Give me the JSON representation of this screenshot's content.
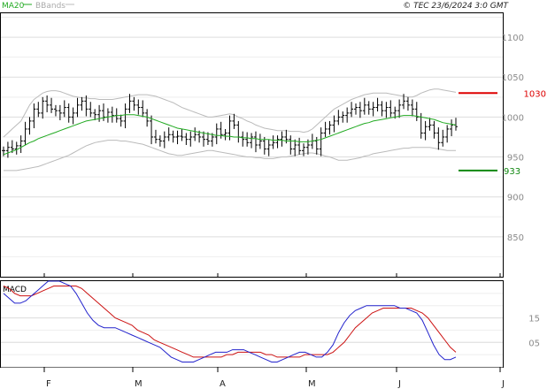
{
  "header": {
    "legend_ma": "MA20",
    "legend_bb": "BBands",
    "copyright": "© TEC 23/6/2024 3:0 GMT"
  },
  "colors": {
    "ma": "#22aa22",
    "bbands": "#bbbbbb",
    "bars": "#000000",
    "grid": "#dddddd",
    "resistance": "#dd0000",
    "support": "#118811",
    "macd": "#2222cc",
    "signal": "#cc1111"
  },
  "chart_data": [
    {
      "type": "ohlc",
      "title": "",
      "ylim": [
        800,
        1130
      ],
      "yticks": [
        850,
        900,
        950,
        1000,
        1050,
        1100
      ],
      "ytick_labels": [
        "850",
        "900",
        "950",
        "1000",
        "1050",
        "1100"
      ],
      "x_months": [
        "F",
        "M",
        "A",
        "M",
        "J",
        "J"
      ],
      "closes": [
        958,
        962,
        960,
        964,
        970,
        985,
        995,
        1010,
        1005,
        1020,
        1015,
        1010,
        1008,
        1005,
        1012,
        1000,
        1005,
        1015,
        1020,
        1010,
        1005,
        1003,
        1008,
        1000,
        1006,
        1002,
        998,
        995,
        1010,
        1020,
        1015,
        1012,
        1005,
        995,
        975,
        972,
        970,
        975,
        978,
        975,
        976,
        975,
        972,
        975,
        978,
        975,
        972,
        970,
        975,
        985,
        978,
        980,
        995,
        990,
        975,
        972,
        968,
        975,
        965,
        970,
        960,
        965,
        968,
        972,
        975,
        972,
        960,
        965,
        958,
        962,
        965,
        970,
        960,
        980,
        985,
        990,
        995,
        1000,
        1002,
        1005,
        1010,
        1012,
        1008,
        1015,
        1010,
        1012,
        1015,
        1008,
        1012,
        1005,
        1008,
        1015,
        1020,
        1015,
        1010,
        1000,
        980,
        988,
        990,
        980,
        968,
        975,
        985,
        990,
        988
      ],
      "ma20": [
        953,
        955,
        957,
        959,
        962,
        965,
        968,
        970,
        973,
        975,
        977,
        979,
        981,
        983,
        985,
        987,
        989,
        991,
        993,
        995,
        996,
        997,
        998,
        999,
        1000,
        1001,
        1002,
        1002,
        1003,
        1003,
        1003,
        1002,
        1001,
        1000,
        998,
        996,
        994,
        992,
        990,
        988,
        986,
        985,
        984,
        983,
        982,
        981,
        980,
        979,
        978,
        977,
        977,
        976,
        976,
        975,
        975,
        974,
        974,
        973,
        973,
        972,
        972,
        972,
        971,
        971,
        971,
        970,
        970,
        970,
        969,
        969,
        969,
        970,
        971,
        972,
        974,
        976,
        978,
        980,
        982,
        984,
        986,
        988,
        990,
        992,
        993,
        995,
        996,
        997,
        998,
        999,
        1000,
        1001,
        1002,
        1002,
        1002,
        1001,
        1000,
        999,
        998,
        997,
        995,
        993,
        992,
        991,
        990
      ],
      "bb_upper": [
        975,
        980,
        985,
        990,
        995,
        1005,
        1015,
        1022,
        1026,
        1030,
        1032,
        1033,
        1033,
        1032,
        1030,
        1028,
        1026,
        1025,
        1024,
        1024,
        1023,
        1023,
        1022,
        1022,
        1022,
        1022,
        1023,
        1024,
        1025,
        1026,
        1027,
        1028,
        1028,
        1028,
        1027,
        1026,
        1024,
        1022,
        1020,
        1018,
        1015,
        1012,
        1010,
        1008,
        1006,
        1004,
        1002,
        1000,
        1000,
        1001,
        1002,
        1003,
        1004,
        1003,
        1000,
        998,
        995,
        993,
        990,
        988,
        986,
        985,
        984,
        983,
        983,
        983,
        982,
        982,
        982,
        981,
        982,
        985,
        990,
        995,
        1000,
        1005,
        1010,
        1013,
        1016,
        1019,
        1022,
        1024,
        1026,
        1028,
        1029,
        1030,
        1030,
        1030,
        1030,
        1029,
        1028,
        1027,
        1026,
        1025,
        1025,
        1027,
        1030,
        1032,
        1034,
        1035,
        1035,
        1034,
        1033,
        1032,
        1031
      ],
      "bb_lower": [
        933,
        933,
        933,
        933,
        934,
        935,
        936,
        937,
        938,
        940,
        942,
        944,
        946,
        948,
        950,
        952,
        955,
        958,
        961,
        964,
        966,
        968,
        969,
        970,
        971,
        971,
        971,
        970,
        970,
        969,
        968,
        967,
        966,
        964,
        962,
        960,
        958,
        956,
        954,
        953,
        952,
        952,
        953,
        954,
        955,
        956,
        957,
        958,
        958,
        957,
        956,
        955,
        954,
        953,
        952,
        951,
        950,
        950,
        949,
        949,
        948,
        948,
        948,
        949,
        950,
        950,
        951,
        952,
        953,
        954,
        955,
        955,
        954,
        953,
        951,
        950,
        948,
        946,
        946,
        946,
        947,
        948,
        949,
        951,
        952,
        954,
        955,
        956,
        957,
        958,
        959,
        960,
        961,
        961,
        962,
        962,
        962,
        962,
        962,
        961,
        960,
        959,
        958,
        958,
        958
      ],
      "resistance": {
        "value": 1030,
        "label": "1030"
      },
      "support": {
        "value": 933,
        "label": "933"
      }
    },
    {
      "type": "line",
      "title": "MACD",
      "ylim": [
        -5,
        30
      ],
      "yticks": [
        5,
        15
      ],
      "ytick_labels": [
        "05",
        "15"
      ],
      "macd": [
        25,
        23,
        21,
        21,
        22,
        24,
        26,
        28,
        30,
        30,
        30,
        29,
        28,
        25,
        21,
        17,
        14,
        12,
        11,
        11,
        11,
        10,
        9,
        8,
        7,
        6,
        5,
        4,
        3,
        1,
        -1,
        -2,
        -3,
        -3,
        -3,
        -2,
        -1,
        0,
        1,
        1,
        1,
        2,
        2,
        2,
        1,
        0,
        -1,
        -2,
        -3,
        -3,
        -2,
        -1,
        0,
        1,
        1,
        0,
        -1,
        -1,
        1,
        4,
        9,
        13,
        16,
        18,
        19,
        20,
        20,
        20,
        20,
        20,
        20,
        19,
        19,
        18,
        17,
        14,
        9,
        4,
        0,
        -2,
        -2,
        -1
      ],
      "signal": [
        28,
        27,
        25,
        24,
        24,
        24,
        25,
        26,
        27,
        28,
        28,
        28,
        28,
        28,
        27,
        25,
        23,
        21,
        19,
        17,
        15,
        14,
        13,
        12,
        10,
        9,
        8,
        6,
        5,
        4,
        3,
        2,
        1,
        0,
        -1,
        -1,
        -1,
        -1,
        -1,
        -1,
        0,
        0,
        1,
        1,
        1,
        1,
        1,
        0,
        0,
        -1,
        -1,
        -1,
        -1,
        -1,
        0,
        0,
        0,
        0,
        0,
        1,
        3,
        5,
        8,
        11,
        13,
        15,
        17,
        18,
        19,
        19,
        19,
        19,
        19,
        19,
        18,
        17,
        15,
        12,
        9,
        6,
        3,
        1
      ]
    }
  ]
}
